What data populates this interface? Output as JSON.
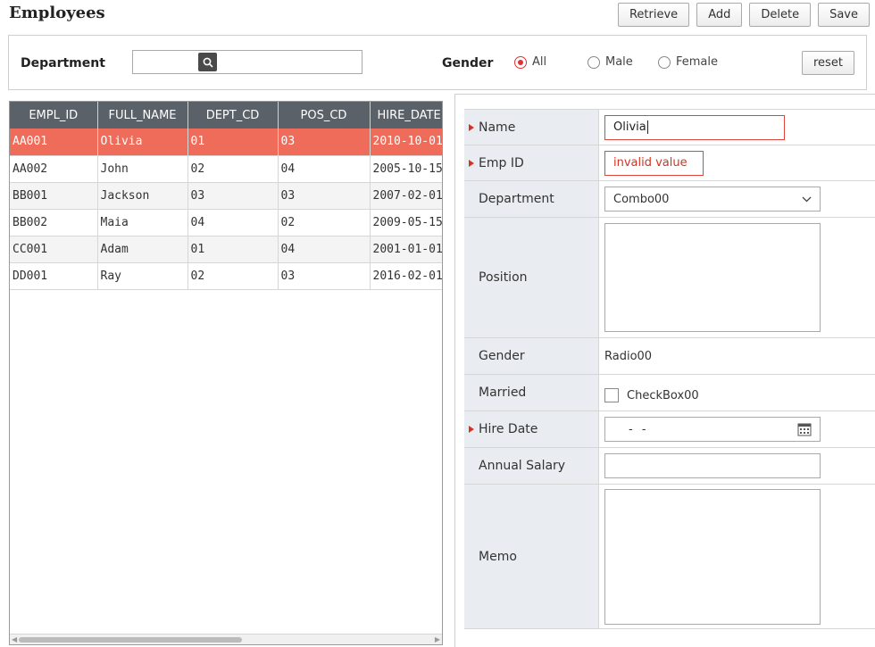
{
  "page": {
    "title": "Employees"
  },
  "toolbar": {
    "retrieve": "Retrieve",
    "add": "Add",
    "delete": "Delete",
    "save": "Save"
  },
  "search": {
    "department_label": "Department",
    "department_value": "",
    "gender_label": "Gender",
    "gender_options": [
      "All",
      "Male",
      "Female"
    ],
    "gender_selected": "All",
    "reset_label": "reset"
  },
  "grid": {
    "columns": [
      "EMPL_ID",
      "FULL_NAME",
      "DEPT_CD",
      "POS_CD",
      "HIRE_DATE"
    ],
    "rows": [
      [
        "AA001",
        "Olivia",
        "01",
        "03",
        "2010-10-01"
      ],
      [
        "AA002",
        "John",
        "02",
        "04",
        "2005-10-15"
      ],
      [
        "BB001",
        "Jackson",
        "03",
        "03",
        "2007-02-01"
      ],
      [
        "BB002",
        "Maia",
        "04",
        "02",
        "2009-05-15"
      ],
      [
        "CC001",
        "Adam",
        "01",
        "04",
        "2001-01-01"
      ],
      [
        "DD001",
        "Ray",
        "02",
        "03",
        "2016-02-01"
      ]
    ],
    "selected_row": 0
  },
  "form": {
    "name_label": "Name",
    "name_value": "Olivia",
    "empid_label": "Emp ID",
    "empid_value": "invalid value",
    "department_label": "Department",
    "department_value": "Combo00",
    "position_label": "Position",
    "gender_label": "Gender",
    "gender_value": "Radio00",
    "married_label": "Married",
    "married_checkbox": "CheckBox00",
    "hiredate_label": "Hire Date",
    "hiredate_value": "- -",
    "salary_label": "Annual Salary",
    "salary_value": "",
    "memo_label": "Memo"
  },
  "colors": {
    "selected_row": "#ee6c59",
    "header": "#5b6168",
    "required_marker": "#d9301f",
    "label_bg": "#e9edf1"
  }
}
